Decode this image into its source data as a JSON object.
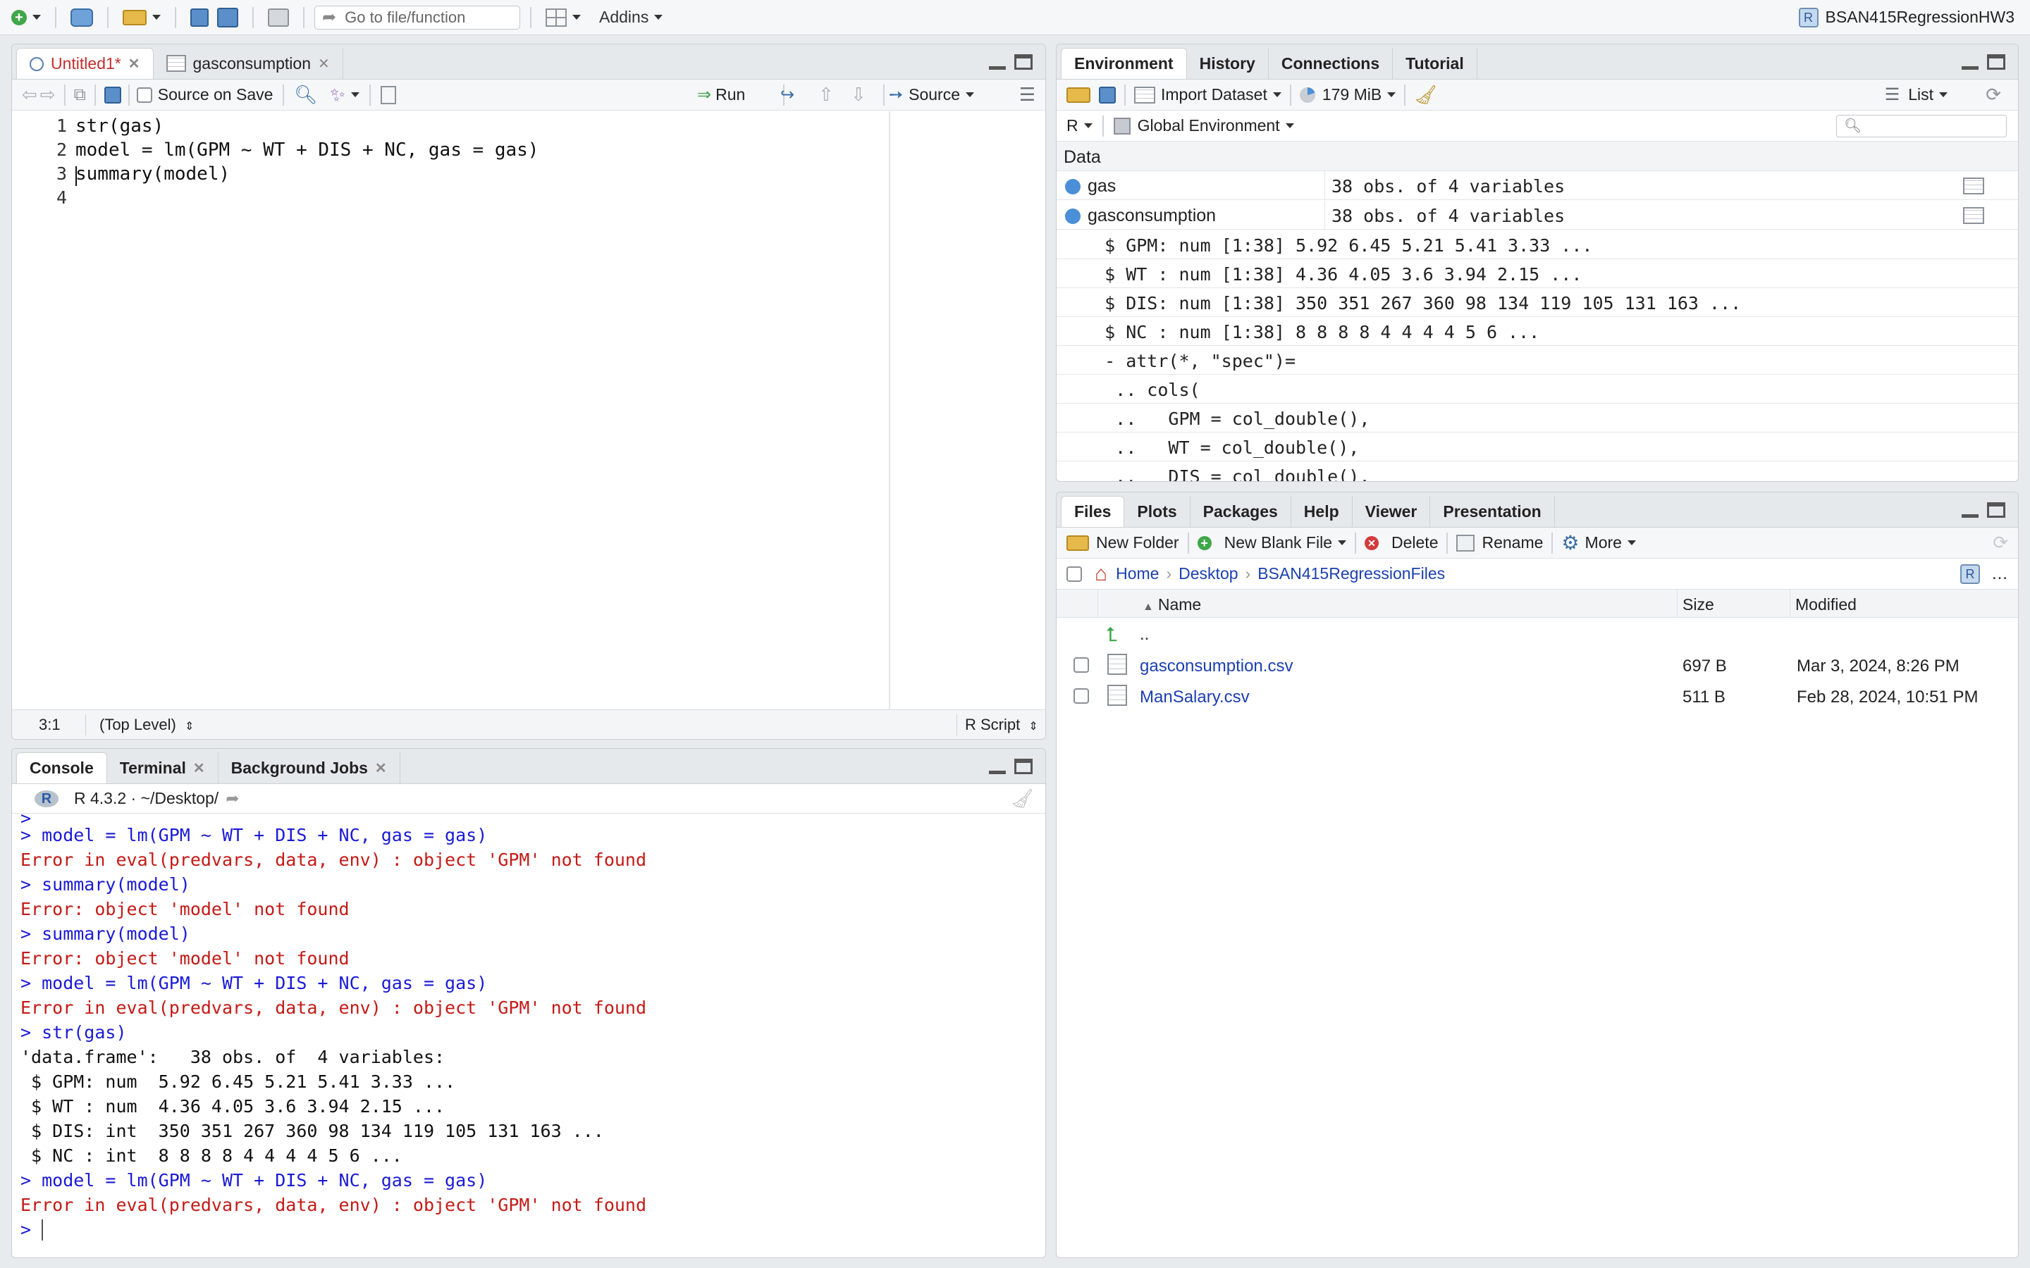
{
  "toolbar": {
    "goto_placeholder": "Go to file/function",
    "addins": "Addins",
    "project": "BSAN415RegressionHW3"
  },
  "editor": {
    "tabs": [
      {
        "label": "Untitled1*"
      },
      {
        "label": "gasconsumption"
      }
    ],
    "source_on_save": "Source on Save",
    "run": "Run",
    "source": "Source",
    "lines": [
      {
        "num": "1",
        "code": "str(gas)"
      },
      {
        "num": "2",
        "code": "model = lm(GPM ~ WT + DIS + NC, gas = gas)"
      },
      {
        "num": "3",
        "code": "summary(model)"
      },
      {
        "num": "4",
        "code": ""
      }
    ],
    "status": {
      "pos": "3:1",
      "scope": "(Top Level)",
      "type": "R Script"
    }
  },
  "console": {
    "tabs": [
      {
        "label": "Console"
      },
      {
        "label": "Terminal"
      },
      {
        "label": "Background Jobs"
      }
    ],
    "header": "R 4.3.2 · ~/Desktop/",
    "lines": [
      {
        "text": ">",
        "cls": "blue"
      },
      {
        "text": "> model = lm(GPM ~ WT + DIS + NC, gas = gas)",
        "cls": "blue"
      },
      {
        "text": "Error in eval(predvars, data, env) : object 'GPM' not found",
        "cls": "red"
      },
      {
        "text": "> summary(model)",
        "cls": "blue"
      },
      {
        "text": "Error: object 'model' not found",
        "cls": "red"
      },
      {
        "text": "> summary(model)",
        "cls": "blue"
      },
      {
        "text": "Error: object 'model' not found",
        "cls": "red"
      },
      {
        "text": "> model = lm(GPM ~ WT + DIS + NC, gas = gas)",
        "cls": "blue"
      },
      {
        "text": "Error in eval(predvars, data, env) : object 'GPM' not found",
        "cls": "red"
      },
      {
        "text": "> str(gas)",
        "cls": "blue"
      },
      {
        "text": "'data.frame':   38 obs. of  4 variables:",
        "cls": "blk"
      },
      {
        "text": " $ GPM: num  5.92 6.45 5.21 5.41 3.33 ...",
        "cls": "blk"
      },
      {
        "text": " $ WT : num  4.36 4.05 3.6 3.94 2.15 ...",
        "cls": "blk"
      },
      {
        "text": " $ DIS: int  350 351 267 360 98 134 119 105 131 163 ...",
        "cls": "blk"
      },
      {
        "text": " $ NC : int  8 8 8 8 4 4 4 4 5 6 ...",
        "cls": "blk"
      },
      {
        "text": "> model = lm(GPM ~ WT + DIS + NC, gas = gas)",
        "cls": "blue"
      },
      {
        "text": "Error in eval(predvars, data, env) : object 'GPM' not found",
        "cls": "red"
      },
      {
        "text": "> ",
        "cls": "blue"
      }
    ]
  },
  "environment": {
    "tabs": [
      {
        "label": "Environment"
      },
      {
        "label": "History"
      },
      {
        "label": "Connections"
      },
      {
        "label": "Tutorial"
      }
    ],
    "import_dataset": "Import Dataset",
    "memory": "179 MiB",
    "view_mode": "List",
    "lang": "R",
    "scope": "Global Environment",
    "section": "Data",
    "objects": [
      {
        "name": "gas",
        "value": "38 obs. of 4 variables"
      },
      {
        "name": "gasconsumption",
        "value": "38 obs. of 4 variables"
      }
    ],
    "details": [
      "  $ GPM: num [1:38] 5.92 6.45 5.21 5.41 3.33 ...",
      "  $ WT : num [1:38] 4.36 4.05 3.6 3.94 2.15 ...",
      "  $ DIS: num [1:38] 350 351 267 360 98 134 119 105 131 163 ...",
      "  $ NC : num [1:38] 8 8 8 8 4 4 4 4 5 6 ...",
      "  - attr(*, \"spec\")=",
      "   .. cols(",
      "   ..   GPM = col_double(),",
      "   ..   WT = col_double(),",
      "   ..   DIS = col_double(),"
    ]
  },
  "files": {
    "tabs": [
      {
        "label": "Files"
      },
      {
        "label": "Plots"
      },
      {
        "label": "Packages"
      },
      {
        "label": "Help"
      },
      {
        "label": "Viewer"
      },
      {
        "label": "Presentation"
      }
    ],
    "new_folder": "New Folder",
    "new_blank_file": "New Blank File",
    "delete": "Delete",
    "rename": "Rename",
    "more": "More",
    "breadcrumb": [
      "Home",
      "Desktop",
      "BSAN415RegressionFiles"
    ],
    "columns": {
      "name": "Name",
      "size": "Size",
      "modified": "Modified"
    },
    "parent": "..",
    "rows": [
      {
        "name": "gasconsumption.csv",
        "size": "697 B",
        "modified": "Mar 3, 2024, 8:26 PM"
      },
      {
        "name": "ManSalary.csv",
        "size": "511 B",
        "modified": "Feb 28, 2024, 10:51 PM"
      }
    ]
  }
}
